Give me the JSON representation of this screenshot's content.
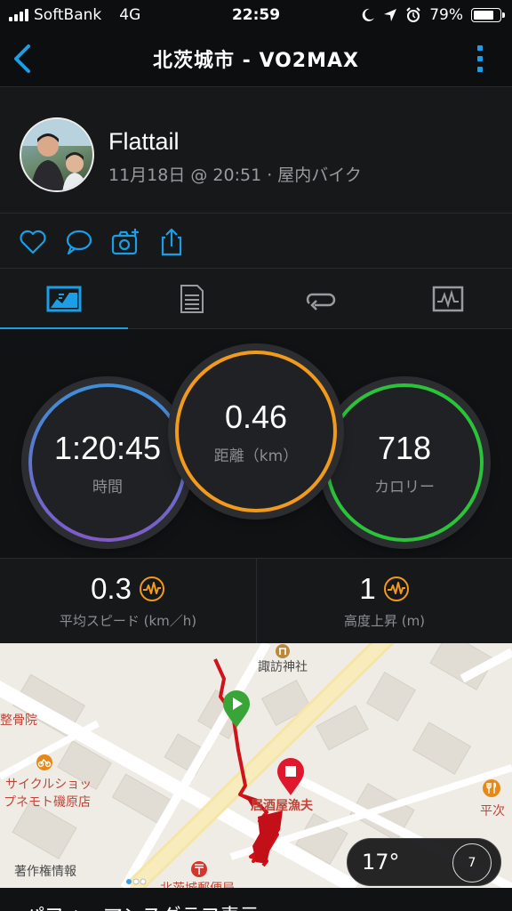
{
  "status": {
    "carrier": "SoftBank",
    "network": "4G",
    "time": "22:59",
    "battery": "79%",
    "battery_level": 0.79
  },
  "nav": {
    "title": "北茨城市 - VO2MAX"
  },
  "activity": {
    "user": "Flattail",
    "meta": "11月18日 @ 20:51 · 屋内バイク"
  },
  "tabs": [
    {
      "icon": "stats-icon",
      "active": true
    },
    {
      "icon": "details-icon",
      "active": false
    },
    {
      "icon": "laps-icon",
      "active": false
    },
    {
      "icon": "graph-icon",
      "active": false
    }
  ],
  "circles": {
    "time": {
      "value": "1:20:45",
      "label": "時間",
      "color": "#3f8fd8"
    },
    "distance": {
      "value": "0.46",
      "label": "距離（km）",
      "color": "#f19a1c"
    },
    "calories": {
      "value": "718",
      "label": "カロリー",
      "color": "#2ac33a"
    }
  },
  "stats": [
    {
      "value": "0.3",
      "label": "平均スピード (km／h)"
    },
    {
      "value": "1",
      "label": "高度上昇 (m)"
    }
  ],
  "map": {
    "labels": {
      "shrine": "諏訪神社",
      "clinic": "整骨院",
      "shop1": "サイクルショッ",
      "shop2": "プネモト磯原店",
      "izakaya": "居酒屋漁夫",
      "heiji": "平次",
      "copyright": "著作権情報",
      "postoffice": "北茨城郵便局"
    },
    "weather": {
      "temperature": "17°",
      "wind": "7"
    }
  },
  "bottom": {
    "text": "パフォーマンスグラフ表示"
  },
  "colors": {
    "accent": "#1a9ee5",
    "route": "#d0121b",
    "start": "#3aa537",
    "end": "#e0182d"
  }
}
